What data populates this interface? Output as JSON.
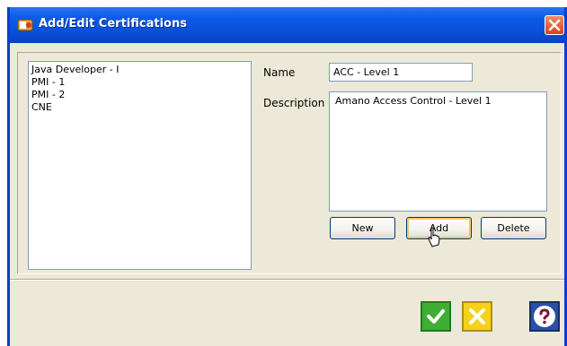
{
  "window": {
    "title": "Add/Edit Certifications",
    "icons": {
      "app": "certification-app-icon",
      "close": "close-icon"
    },
    "colors": {
      "titlebar": "#0a4fd8",
      "face": "#ece9d8",
      "close": "#d9421c"
    }
  },
  "certifications": {
    "items": [
      "Java Developer - I",
      "PMI - 1",
      "PMI - 2",
      "CNE"
    ]
  },
  "form": {
    "name_label": "Name",
    "name_value": "ACC - Level 1",
    "description_label": "Description",
    "description_value": "Amano Access Control - Level 1"
  },
  "buttons": {
    "new_label": "New",
    "add_label": "Add",
    "delete_label": "Delete"
  },
  "footer": {
    "ok_icon": "checkmark-icon",
    "cancel_icon": "x-icon",
    "help_icon": "question-mark-icon",
    "colors": {
      "ok": "#3fae35",
      "cancel": "#f4d21c",
      "help": "#2a4fa8"
    }
  }
}
